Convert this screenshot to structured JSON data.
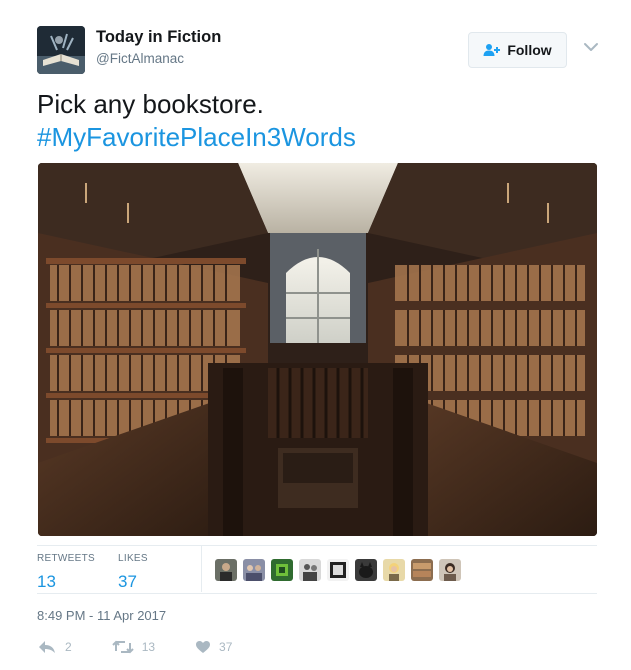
{
  "account": {
    "display_name": "Today in Fiction",
    "handle": "@FictAlmanac",
    "avatar_icon": "open-book-icon"
  },
  "follow_button": {
    "label": "Follow",
    "icon": "add-user-icon",
    "color": "#1da1f2"
  },
  "more_menu": {
    "icon": "chevron-down-icon"
  },
  "tweet": {
    "text": "Pick any bookstore.",
    "hashtag": "#MyFavoritePlaceIn3Words",
    "hashtag_color": "#1b95e0",
    "photo": {
      "subject": "bookstore interior photo"
    }
  },
  "stats": {
    "retweets_label": "RETWEETS",
    "retweets_value": "13",
    "likes_label": "LIKES",
    "likes_value": "37",
    "liker_avatars": [
      {
        "icon": "person-avatar"
      },
      {
        "icon": "group-avatar"
      },
      {
        "icon": "green-logo-avatar"
      },
      {
        "icon": "people-avatar"
      },
      {
        "icon": "monochrome-avatar"
      },
      {
        "icon": "cat-avatar"
      },
      {
        "icon": "blonde-person-avatar"
      },
      {
        "icon": "books-avatar"
      },
      {
        "icon": "woman-avatar"
      }
    ]
  },
  "timestamp": "8:49 PM - 11 Apr 2017",
  "actions": {
    "reply_count": "2",
    "retweet_count": "13",
    "like_count": "37"
  }
}
